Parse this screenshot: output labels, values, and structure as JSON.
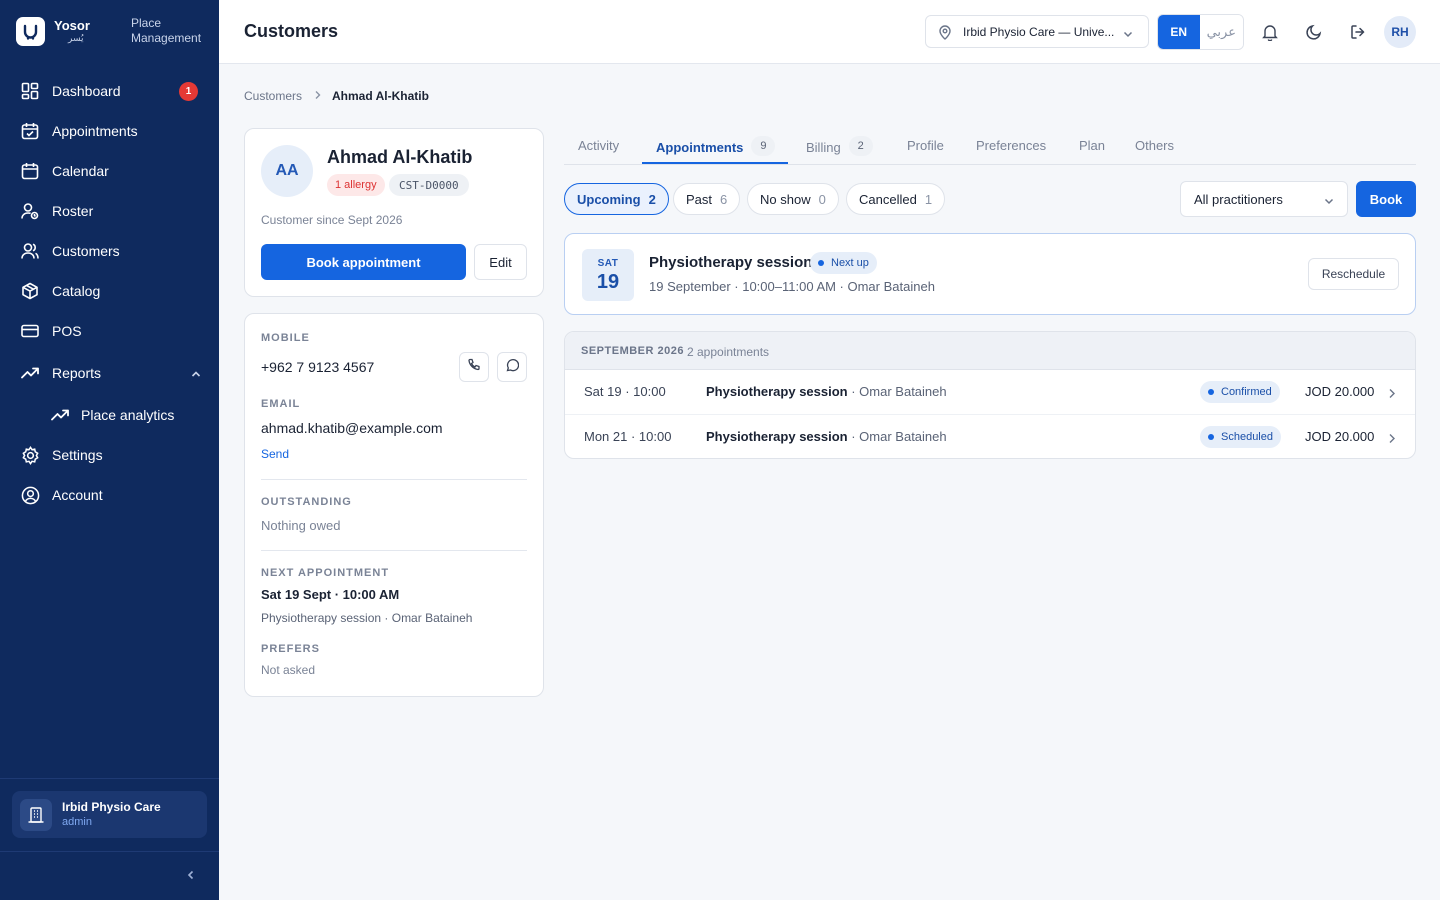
{
  "sidebar": {
    "brand": {
      "name": "Yosor",
      "name_ar": "يُسر",
      "module": "Place Management"
    },
    "items": [
      {
        "label": "Dashboard",
        "badge": "1"
      },
      {
        "label": "Appointments"
      },
      {
        "label": "Calendar"
      },
      {
        "label": "Roster"
      },
      {
        "label": "Customers"
      },
      {
        "label": "Catalog"
      },
      {
        "label": "POS"
      },
      {
        "label": "Reports"
      },
      {
        "label": "Place analytics"
      },
      {
        "label": "Settings"
      },
      {
        "label": "Account"
      }
    ],
    "place": {
      "name": "Irbid Physio Care",
      "role": "admin"
    }
  },
  "topbar": {
    "title": "Customers",
    "location": "Irbid Physio Care — Unive...",
    "lang_en": "EN",
    "lang_ar": "عربي",
    "user_initials": "RH"
  },
  "breadcrumb": {
    "parent": "Customers",
    "current": "Ahmad Al-Khatib"
  },
  "profile": {
    "initials": "AA",
    "name": "Ahmad Al-Khatib",
    "allergy": "1 allergy",
    "code": "CST-D0000",
    "since": "Customer since Sept 2026",
    "book_label": "Book appointment",
    "edit_label": "Edit"
  },
  "details": {
    "mobile_label": "MOBILE",
    "mobile": "+962 7 9123 4567",
    "email_label": "EMAIL",
    "email": "ahmad.khatib@example.com",
    "send_label": "Send",
    "outstanding_label": "OUTSTANDING",
    "outstanding": "Nothing owed",
    "next_label": "NEXT APPOINTMENT",
    "next_when": "Sat 19 Sept · 10:00 AM",
    "next_what": "Physiotherapy session · Omar Bataineh",
    "prefers_label": "PREFERS",
    "prefers": "Not asked"
  },
  "tabs": [
    {
      "label": "Activity"
    },
    {
      "label": "Appointments",
      "count": "9"
    },
    {
      "label": "Billing",
      "count": "2"
    },
    {
      "label": "Profile"
    },
    {
      "label": "Preferences"
    },
    {
      "label": "Plan"
    },
    {
      "label": "Others"
    }
  ],
  "filters": [
    {
      "label": "Upcoming",
      "count": "2"
    },
    {
      "label": "Past",
      "count": "6"
    },
    {
      "label": "No show",
      "count": "0"
    },
    {
      "label": "Cancelled",
      "count": "1"
    }
  ],
  "practitioner_select": "All practitioners",
  "book_label": "Book",
  "next_up": {
    "dow": "SAT",
    "day": "19",
    "title": "Physiotherapy session",
    "badge": "Next up",
    "sub": "19 September · 10:00–11:00 AM · Omar Bataineh",
    "reschedule_label": "Reschedule"
  },
  "list": {
    "month": "SEPTEMBER 2026",
    "count": "2 appointments",
    "rows": [
      {
        "when": "Sat 19 · 10:00",
        "service": "Physiotherapy session",
        "practitioner": " · Omar Bataineh",
        "status": "Confirmed",
        "price": "JOD 20.000"
      },
      {
        "when": "Mon 21 · 10:00",
        "service": "Physiotherapy session",
        "practitioner": " · Omar Bataineh",
        "status": "Scheduled",
        "price": "JOD 20.000"
      }
    ]
  },
  "colors": {
    "sidebar": "#0f2a5e",
    "accent": "#1565e0",
    "danger": "#e53935"
  }
}
